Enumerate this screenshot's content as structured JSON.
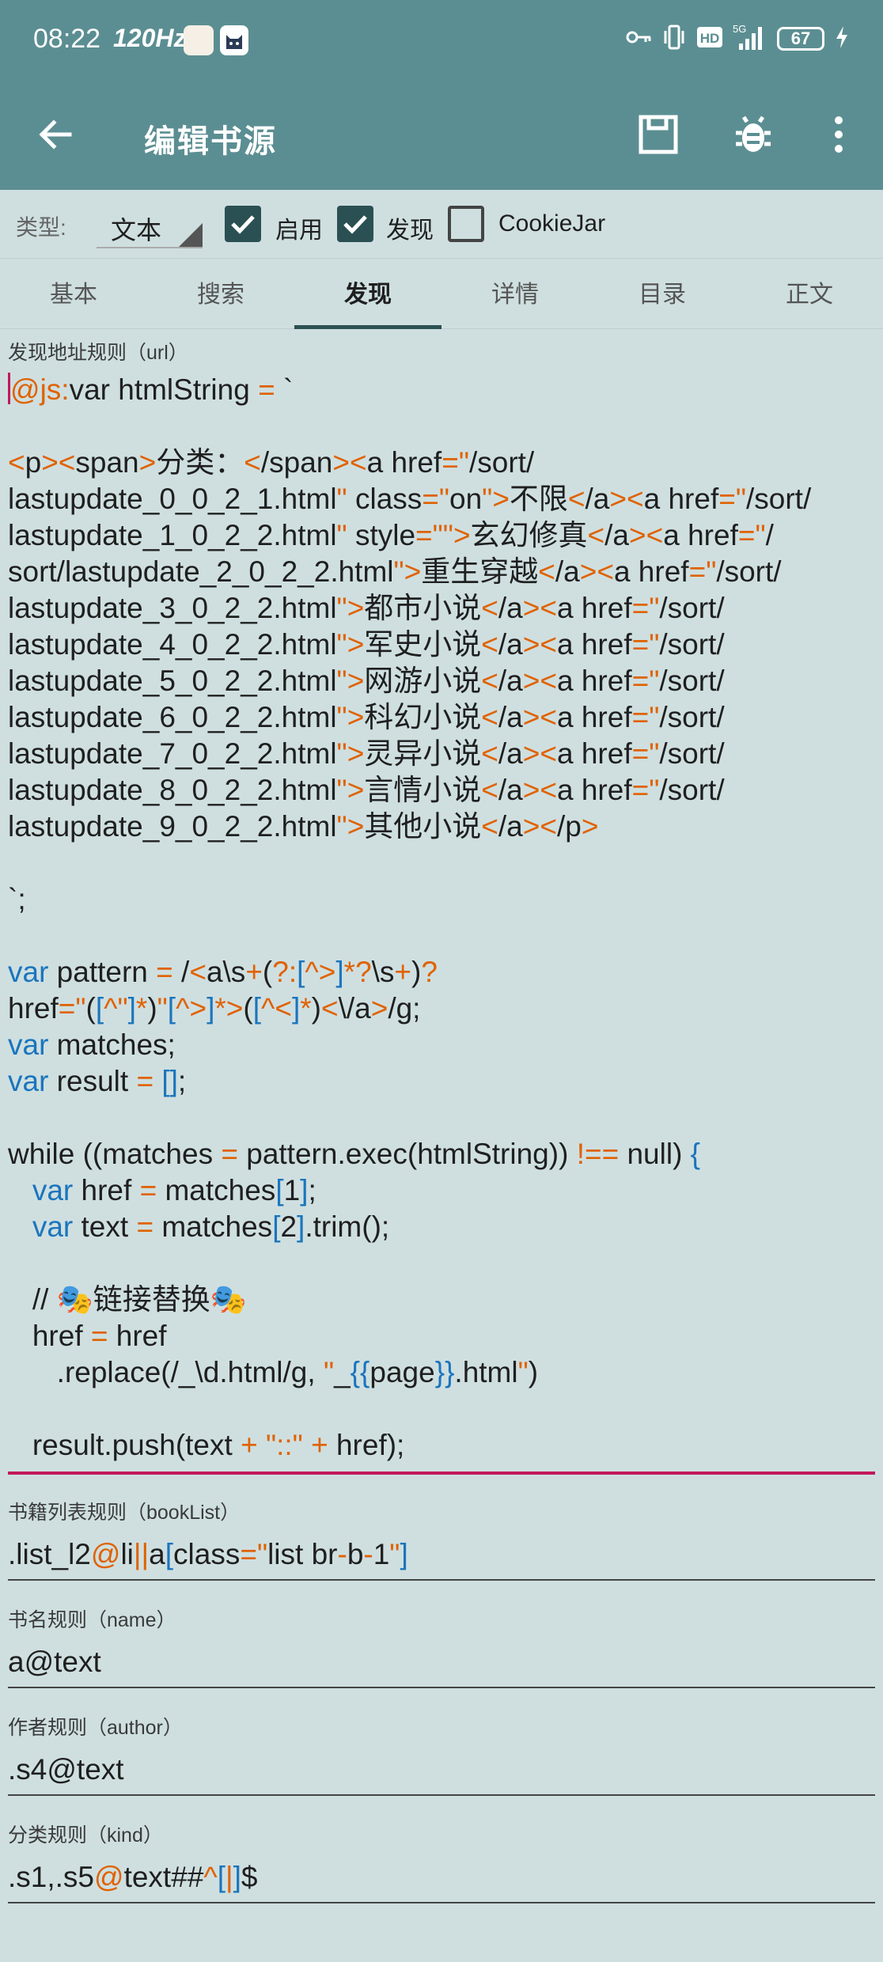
{
  "status_bar": {
    "time": "08:22",
    "refresh_rate": "120Hz",
    "network": "5G",
    "battery": "67"
  },
  "app_bar": {
    "title": "编辑书源"
  },
  "options": {
    "type_label": "类型:",
    "type_value": "文本",
    "enable_label": "启用",
    "explore_label": "发现",
    "cookiejar_label": "CookieJar"
  },
  "tabs": [
    {
      "label": "基本"
    },
    {
      "label": "搜索"
    },
    {
      "label": "发现"
    },
    {
      "label": "详情"
    },
    {
      "label": "目录"
    },
    {
      "label": "正文"
    }
  ],
  "fields": {
    "explore_url": {
      "label": "发现地址规则（url）",
      "code_lines": [
        "@js:var htmlString = `",
        "",
        "<p><span>分类：</span><a href=\"/sort/",
        "lastupdate_0_0_2_1.html\" class=\"on\">不限</a><a href=\"/sort/",
        "lastupdate_1_0_2_2.html\" style=\"\">玄幻修真</a><a href=\"/",
        "sort/lastupdate_2_0_2_2.html\">重生穿越</a><a href=\"/sort/",
        "lastupdate_3_0_2_2.html\">都市小说</a><a href=\"/sort/",
        "lastupdate_4_0_2_2.html\">军史小说</a><a href=\"/sort/",
        "lastupdate_5_0_2_2.html\">网游小说</a><a href=\"/sort/",
        "lastupdate_6_0_2_2.html\">科幻小说</a><a href=\"/sort/",
        "lastupdate_7_0_2_2.html\">灵异小说</a><a href=\"/sort/",
        "lastupdate_8_0_2_2.html\">言情小说</a><a href=\"/sort/",
        "lastupdate_9_0_2_2.html\">其他小说</a></p>",
        "",
        "`;",
        "",
        "var pattern = /<a\\s+(?:[^>]*?\\s+)?",
        "href=\"([^\"]*)\"[^>]*>([^<]*)<\\/a>/g;",
        "var matches;",
        "var result = [];",
        "",
        "while ((matches = pattern.exec(htmlString)) !== null) {",
        "   var href = matches[1];",
        "   var text = matches[2].trim();",
        "",
        "   // 🎭链接替换🎭",
        "   href = href",
        "      .replace(/_\\d.html/g, \"_{{page}}.html\")",
        "",
        "   result.push(text + \"::\" + href);"
      ]
    },
    "book_list": {
      "label": "书籍列表规则（bookList）",
      "value": ".list_l2@li||a[class=\"list br-b-1\"]"
    },
    "name": {
      "label": "书名规则（name）",
      "value": "a@text"
    },
    "author": {
      "label": "作者规则（author）",
      "value": ".s4@text"
    },
    "kind": {
      "label": "分类规则（kind）",
      "value": ".s1,.s5@text##^[|]$"
    }
  },
  "colors": {
    "app_bar": "#5b8e92",
    "background": "#cfdfe0",
    "accent": "#2b5053",
    "syntax_operator": "#e06200",
    "syntax_keyword": "#1a75bd",
    "focus_underline": "#c2185b"
  }
}
